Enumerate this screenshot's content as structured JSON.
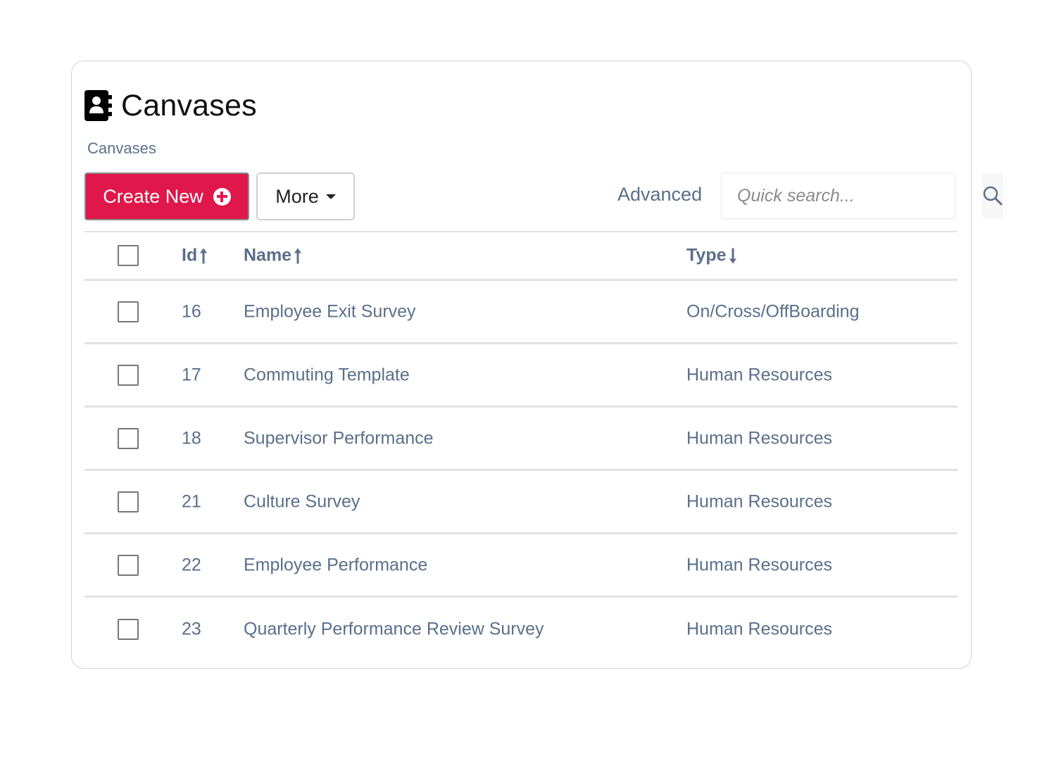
{
  "page": {
    "title": "Canvases",
    "title_icon": "address-book-icon",
    "breadcrumb": "Canvases"
  },
  "toolbar": {
    "create_label": "Create New",
    "create_icon": "plus-circle-icon",
    "more_label": "More",
    "advanced_label": "Advanced",
    "search_placeholder": "Quick search...",
    "search_value": "",
    "colors": {
      "create_bg": "#e0174a",
      "text": "#5a6f8a"
    }
  },
  "table": {
    "columns": [
      {
        "label": "Id",
        "sort": "asc"
      },
      {
        "label": "Name",
        "sort": "asc"
      },
      {
        "label": "Type",
        "sort": "desc"
      }
    ],
    "rows": [
      {
        "id": "16",
        "name": "Employee Exit Survey",
        "type": "On/Cross/OffBoarding",
        "checked": false
      },
      {
        "id": "17",
        "name": "Commuting Template",
        "type": "Human Resources",
        "checked": false
      },
      {
        "id": "18",
        "name": "Supervisor Performance",
        "type": "Human Resources",
        "checked": false
      },
      {
        "id": "21",
        "name": "Culture Survey",
        "type": "Human Resources",
        "checked": false
      },
      {
        "id": "22",
        "name": "Employee Performance",
        "type": "Human Resources",
        "checked": false
      },
      {
        "id": "23",
        "name": "Quarterly Performance Review Survey",
        "type": "Human Resources",
        "checked": false
      }
    ]
  }
}
